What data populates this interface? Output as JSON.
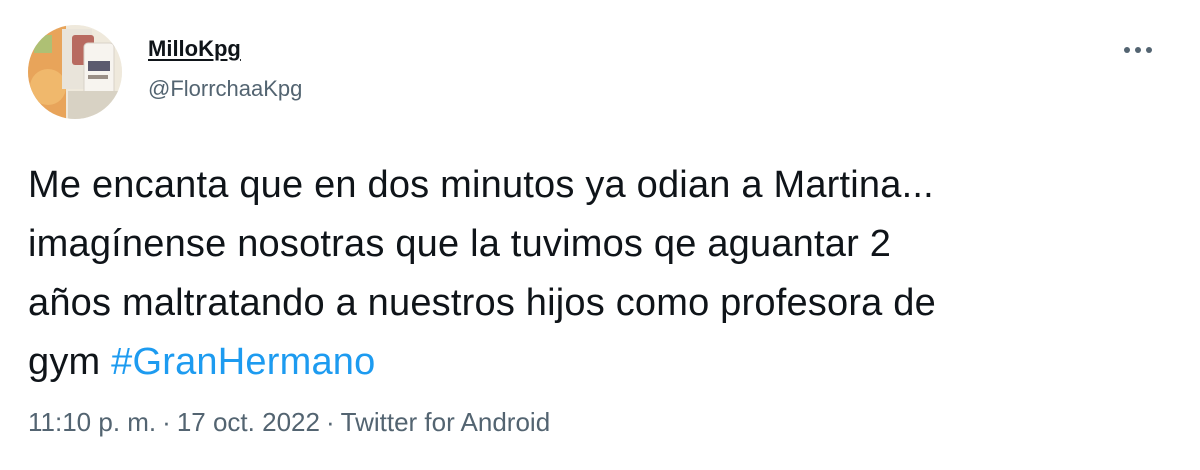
{
  "user": {
    "display_name": "MilloKpg",
    "handle": "@FlorrchaaKpg"
  },
  "tweet": {
    "text_lines": [
      "Me encanta que en dos minutos ya odian a Martina...",
      "imagínense nosotras que la tuvimos qe aguantar 2",
      "años maltratando a nuestros hijos como profesora de",
      "gym"
    ],
    "hashtag": "#GranHermano",
    "time": "11:10 p. m.",
    "separator": "·",
    "date": "17 oct. 2022",
    "source": "Twitter for Android"
  },
  "icons": {
    "more": "more-horizontal-icon",
    "avatar": "avatar-image"
  },
  "colors": {
    "text": "#0f1419",
    "secondary": "#536471",
    "link": "#1d9bf0",
    "background": "#ffffff"
  }
}
